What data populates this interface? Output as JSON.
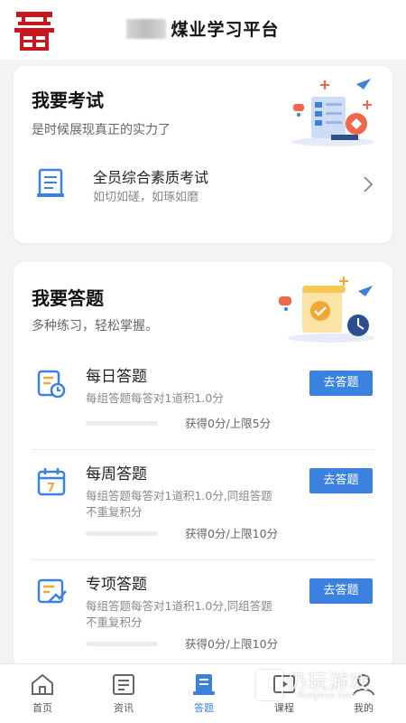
{
  "header": {
    "title": "煤业学习平台",
    "brand_color": "#c8161d"
  },
  "exam_section": {
    "title": "我要考试",
    "subtitle": "是时候展现真正的实力了",
    "item": {
      "name": "全员综合素质考试",
      "desc": "如切如磋，如琢如磨"
    }
  },
  "quiz_section": {
    "title": "我要答题",
    "subtitle": "多种练习，轻松掌握。",
    "items": [
      {
        "name": "每日答题",
        "desc": "每组答题每答对1道积1.0分",
        "button": "去答题",
        "score": "获得0分/上限5分",
        "progress": 0
      },
      {
        "name": "每周答题",
        "desc": "每组答题每答对1道积1.0分,同组答题不重复积分",
        "button": "去答题",
        "score": "获得0分/上限10分",
        "progress": 0
      },
      {
        "name": "专项答题",
        "desc": "每组答题每答对1道积1.0分,同组答题不重复积分",
        "button": "去答题",
        "score": "获得0分/上限10分",
        "progress": 0
      }
    ]
  },
  "tabbar": {
    "active": "答题",
    "accent": "#3b82e0",
    "tabs": [
      {
        "label": "首页",
        "icon": "home-icon"
      },
      {
        "label": "资讯",
        "icon": "news-icon"
      },
      {
        "label": "答题",
        "icon": "quiz-icon"
      },
      {
        "label": "课程",
        "icon": "course-icon"
      },
      {
        "label": "我的",
        "icon": "profile-icon"
      }
    ]
  },
  "watermark": {
    "text": "仍玩游戏",
    "sub": "Rengwan.com"
  }
}
